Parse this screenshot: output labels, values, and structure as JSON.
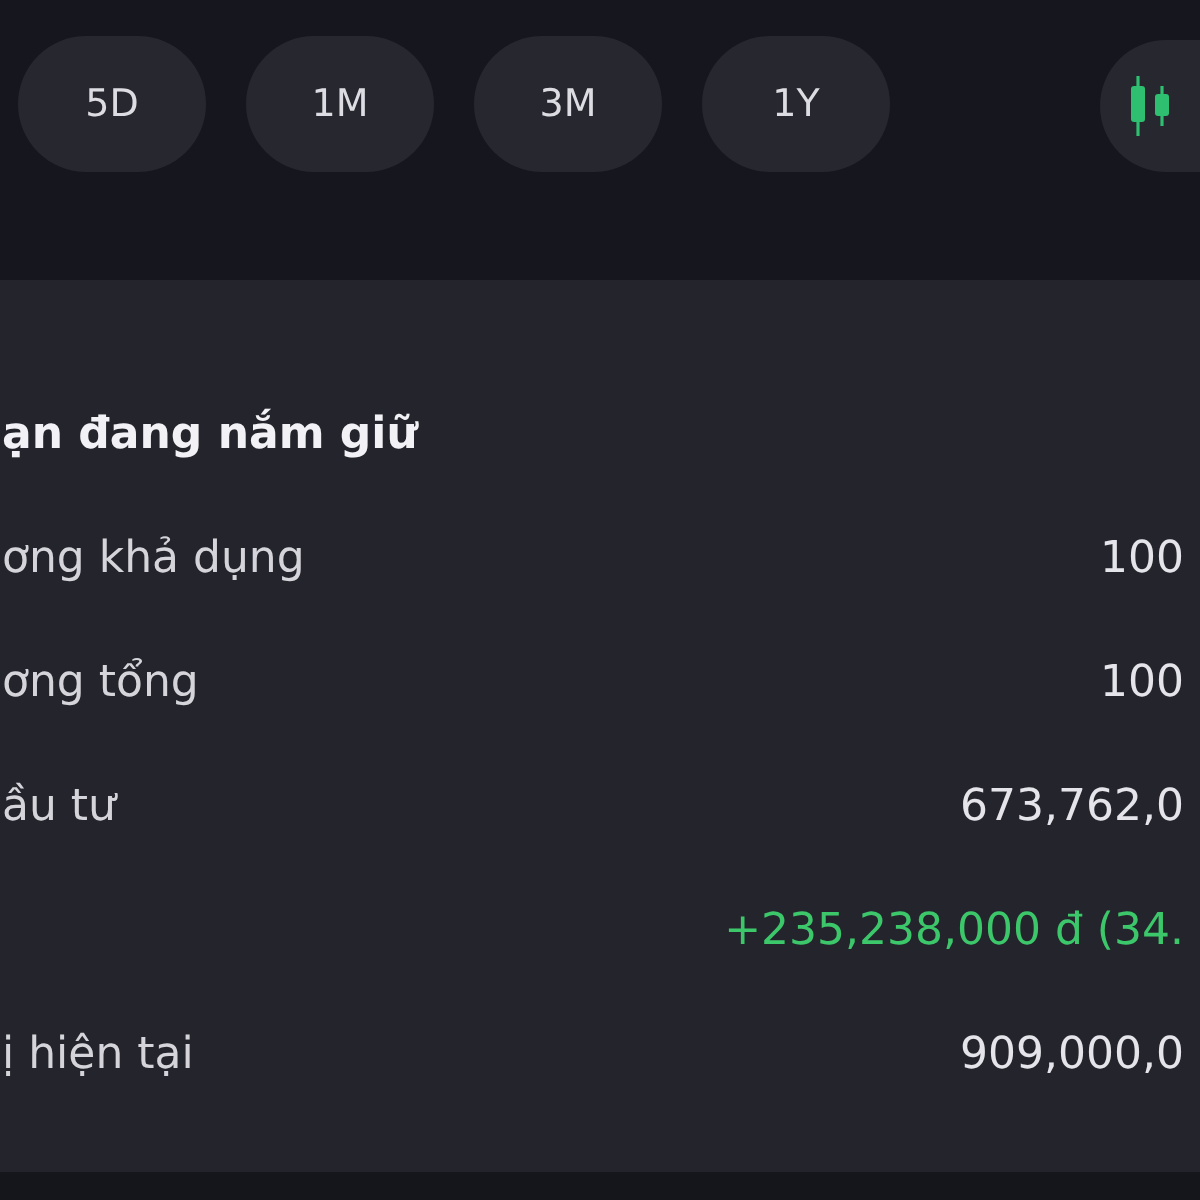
{
  "timeframe_tabs": [
    {
      "label": "5D",
      "selected": false
    },
    {
      "label": "1M",
      "selected": false
    },
    {
      "label": "3M",
      "selected": false
    },
    {
      "label": "1Y",
      "selected": false
    }
  ],
  "holdings": {
    "title": "ạn đang nắm giữ",
    "rows": [
      {
        "kind": "plain",
        "label": "ơng khả dụng",
        "value": "100"
      },
      {
        "kind": "plain",
        "label": "ơng tổng",
        "value": "100"
      },
      {
        "kind": "plain",
        "label": "ầu tư",
        "value": "673,762,0"
      },
      {
        "kind": "gain",
        "value": "+235,238,000 đ (34."
      },
      {
        "kind": "plain",
        "label": "ị hiện tại",
        "value": "909,000,0"
      }
    ]
  }
}
